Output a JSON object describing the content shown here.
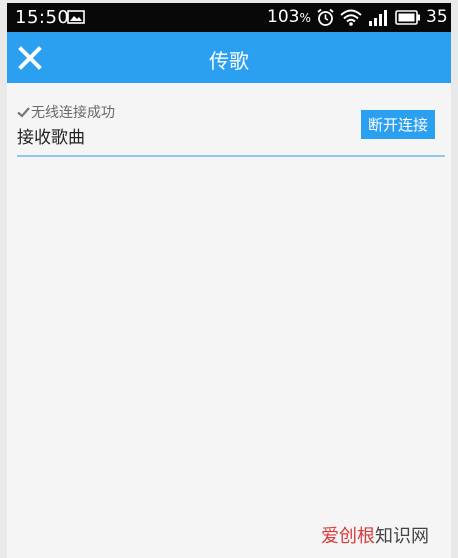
{
  "status_bar": {
    "time": "15:50",
    "battery_percent": "103",
    "percent_sign": "%",
    "right_number": "35",
    "icons": [
      "gallery-icon",
      "alarm-icon",
      "wifi-icon",
      "signal-icon",
      "battery-icon"
    ]
  },
  "app_bar": {
    "title": "传歌",
    "close_icon": "close-icon",
    "background_color": "#2b9ff0"
  },
  "connection": {
    "status_icon": "check-icon",
    "status_text": "无线连接成功",
    "title": "接收歌曲",
    "disconnect_label": "断开连接"
  },
  "watermark": {
    "part1": "爱创根",
    "part2": "知识网"
  }
}
